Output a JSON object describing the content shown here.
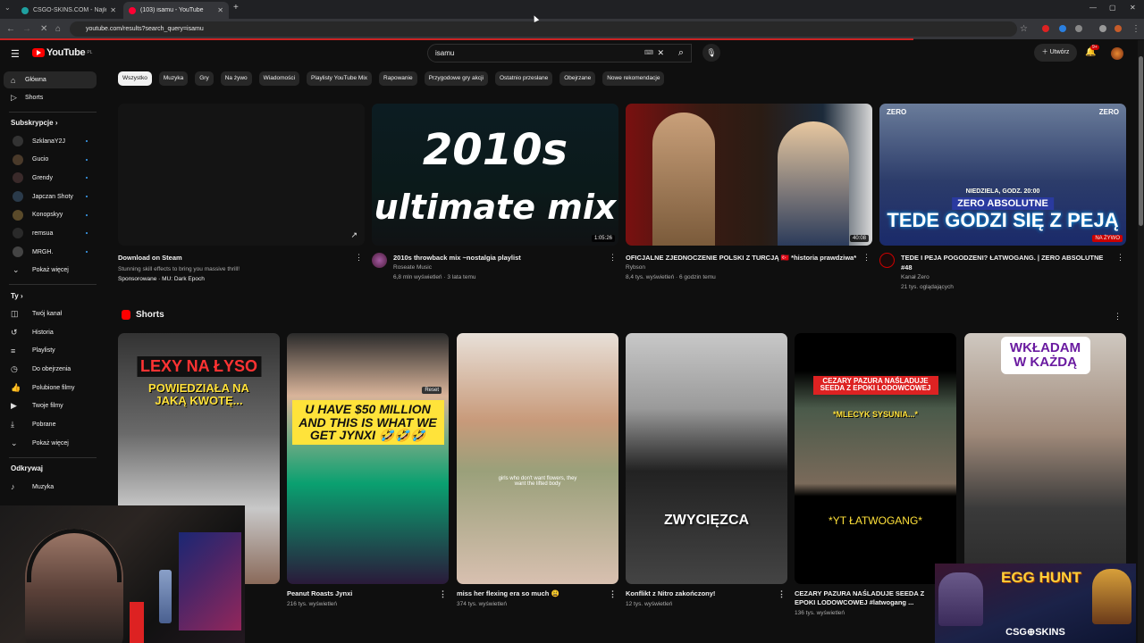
{
  "browser": {
    "tabs": [
      {
        "title": "CSGO-SKINS.COM - Najlepsza",
        "active": false,
        "favicon_color": "#1fa0a0"
      },
      {
        "title": "(103) isamu - YouTube",
        "active": true,
        "favicon_color": "#ff0033"
      }
    ],
    "url": "youtube.com/results?search_query=isamu"
  },
  "youtube": {
    "logo_text": "YouTube",
    "region": "PL",
    "search_value": "isamu",
    "create_label": "Utwórz",
    "notification_count": "9+"
  },
  "sidebar": {
    "main": [
      {
        "label": "Główna",
        "icon": "home-icon"
      },
      {
        "label": "Shorts",
        "icon": "shorts-icon"
      }
    ],
    "subscriptions_title": "Subskrypcje",
    "subscriptions": [
      "SzklanaY2J",
      "Gucio",
      "Grendy",
      "Japczan Shoty",
      "Konopskyy",
      "remsua",
      "MRGH."
    ],
    "show_more": "Pokaż więcej",
    "you_title": "Ty",
    "you": [
      {
        "label": "Twój kanał",
        "icon": "account-icon"
      },
      {
        "label": "Historia",
        "icon": "history-icon"
      },
      {
        "label": "Playlisty",
        "icon": "playlist-icon"
      },
      {
        "label": "Do obejrzenia",
        "icon": "watch-later-icon"
      },
      {
        "label": "Polubione filmy",
        "icon": "like-icon"
      },
      {
        "label": "Twoje filmy",
        "icon": "your-videos-icon"
      },
      {
        "label": "Pobrane",
        "icon": "download-icon"
      },
      {
        "label": "Pokaż więcej",
        "icon": "chevron-down-icon"
      }
    ],
    "explore_title": "Odkrywaj",
    "explore": [
      {
        "label": "Muzyka",
        "icon": "music-icon"
      }
    ]
  },
  "chips": [
    "Wszystko",
    "Muzyka",
    "Gry",
    "Na żywo",
    "Wiadomości",
    "Playlisty YouTube Mix",
    "Rapowanie",
    "Przygodowe gry akcji",
    "Ostatnio przesłane",
    "Obejrzane",
    "Nowe rekomendacje"
  ],
  "videos": [
    {
      "title": "Download on Steam",
      "line1": "Stunning skill effects to bring you massive thrill!",
      "line2": "Sponsorowane · MU: Dark Epoch",
      "duration": "",
      "avatar": false
    },
    {
      "title": "2010s throwback mix ~nostalgia playlist",
      "line1": "Roseate Music",
      "line2": "6,8 mln wyświetleń · 3 lata temu",
      "duration": "1:05:26",
      "thumb_text1": "2010s",
      "thumb_text2": "ultimate mix",
      "avatar": true
    },
    {
      "title": "OFICJALNE ZJEDNOCZENIE POLSKI Z TURCJĄ 🇹🇷 *historia prawdziwa*",
      "line1": "Rybson",
      "line2": "8,4 tys. wyświetleń · 6 godzin temu",
      "duration": "40:08",
      "avatar": false
    },
    {
      "title": "TEDE I PEJA POGODZENI? ŁATWOGANG. | ZERO ABSOLUTNE #48",
      "line1": "Kanał Zero",
      "line2": "21 tys. oglądających",
      "duration": "NA ŻYWO",
      "thumb_date": "NIEDZIELA, GODZ. 20:00",
      "thumb_show": "ZERO ABSOLUTNE",
      "thumb_headline": "TEDE GODZI SIĘ Z PEJĄ",
      "thumb_brand": "ZERO",
      "avatar": true
    }
  ],
  "shorts_title": "Shorts",
  "shorts": [
    {
      "title": "",
      "views": "",
      "cap1": "LEXY NA ŁYSO",
      "cap2": "POWIEDZIAŁA NA JAKĄ KWOTĘ..."
    },
    {
      "title": "Peanut Roasts Jynxi",
      "views": "216 tys. wyświetleń",
      "cap1": "U HAVE $50 MILLION AND THIS IS WHAT WE GET JYNXI 🤣🤣🤣",
      "badge": "Reset"
    },
    {
      "title": "miss her flexing era so much 😩",
      "views": "374 tys. wyświetleń",
      "cap1": "girls who don't want flowers, they want the lifted body"
    },
    {
      "title": "Konflikt z Nitro zakończony!",
      "views": "12 tys. wyświetleń",
      "cap1": "ZWYCIĘZCA"
    },
    {
      "title": "CEZARY PAZURA NAŚLADUJE SEEDA Z EPOKI LODOWCOWEJ #latwogang ...",
      "views": "136 tys. wyświetleń",
      "cap1": "CEZARY PAZURA NAŚLADUJE SEEDA Z EPOKI LODOWCOWEJ",
      "cap2": "*MLECYK SYSUNIA...*",
      "cap3": "*YT ŁATWOGANG*"
    },
    {
      "title": "",
      "views": "",
      "cap1": "WKŁADAM W KAŻDĄ"
    }
  ],
  "overlay": {
    "egg_hunt": "EGG HUNT",
    "brand": "CSG⊕SKINS"
  }
}
